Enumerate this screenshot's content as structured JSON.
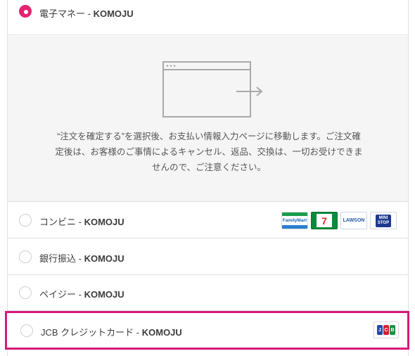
{
  "payment_methods": {
    "emoney": {
      "label": "電子マネー - ",
      "provider": "KOMOJU",
      "selected": true
    },
    "info": {
      "text": "“注文を確定する”を選択後、お支払い情報入力ページに移動します。ご注文確定後は、お客様のご事情によるキャンセル、返品、交換は、一切お受けできませんので、ご注意ください。"
    },
    "konbini": {
      "label": "コンビニ - ",
      "provider": "KOMOJU",
      "selected": false,
      "stores": [
        "FamilyMart",
        "7 ELEVEN",
        "LAWSON",
        "MINI STOP"
      ]
    },
    "bank": {
      "label": "銀行振込 - ",
      "provider": "KOMOJU",
      "selected": false
    },
    "payeasy": {
      "label": "ペイジー - ",
      "provider": "KOMOJU",
      "selected": false
    },
    "jcb": {
      "label": "JCB クレジットカード - ",
      "provider": "KOMOJU",
      "selected": false,
      "logo": "JCB"
    }
  },
  "colors": {
    "accent": "#e5236f",
    "highlight": "#d8197b",
    "info_bg": "#f5f5f5"
  }
}
